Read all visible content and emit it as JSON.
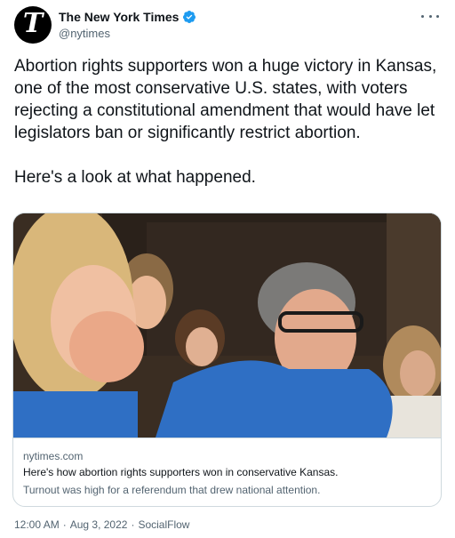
{
  "account": {
    "display_name": "The New York Times",
    "handle": "@nytimes",
    "avatar_letter": "T",
    "verified_color": "#1d9bf0"
  },
  "tweet": {
    "text_main": "Abortion rights supporters won a huge victory in Kansas, one of the most conservative U.S. states, with voters rejecting a constitutional amendment that would have let legislators ban or significantly restrict abortion.",
    "text_followup": "Here's a look at what happened."
  },
  "card": {
    "image_alt": "Supporters in blue shirts cry and cheer at a watch party",
    "domain": "nytimes.com",
    "title": "Here's how abortion rights supporters won in conservative Kansas.",
    "description": "Turnout was high for a referendum that drew national attention."
  },
  "meta": {
    "time": "12:00 AM",
    "separator_1": "·",
    "date": "Aug 3, 2022",
    "separator_2": "·",
    "source": "SocialFlow"
  },
  "icons": {
    "more": "more-dots-icon",
    "verified": "verified-badge-icon"
  }
}
